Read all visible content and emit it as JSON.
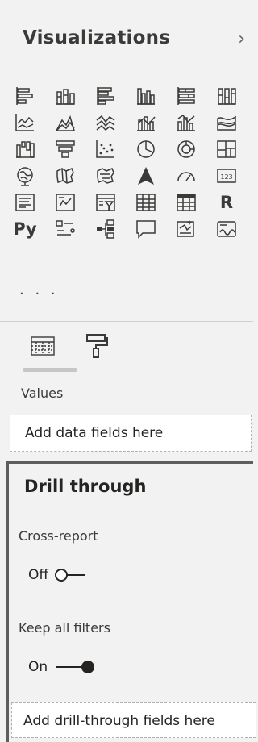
{
  "header": {
    "title": "Visualizations",
    "expand_glyph": "›"
  },
  "visuals": [
    {
      "icon": "stacked-bar-chart-icon"
    },
    {
      "icon": "stacked-column-chart-icon"
    },
    {
      "icon": "clustered-bar-chart-icon"
    },
    {
      "icon": "clustered-column-chart-icon"
    },
    {
      "icon": "100-percent-stacked-bar-chart-icon"
    },
    {
      "icon": "100-percent-stacked-column-chart-icon"
    },
    {
      "icon": "line-chart-icon"
    },
    {
      "icon": "area-chart-icon"
    },
    {
      "icon": "stacked-area-chart-icon"
    },
    {
      "icon": "line-and-stacked-column-chart-icon"
    },
    {
      "icon": "line-and-clustered-column-chart-icon"
    },
    {
      "icon": "ribbon-chart-icon"
    },
    {
      "icon": "waterfall-chart-icon"
    },
    {
      "icon": "funnel-icon"
    },
    {
      "icon": "scatter-chart-icon"
    },
    {
      "icon": "pie-chart-icon"
    },
    {
      "icon": "donut-chart-icon"
    },
    {
      "icon": "treemap-icon"
    },
    {
      "icon": "map-icon"
    },
    {
      "icon": "filled-map-icon"
    },
    {
      "icon": "shape-map-icon"
    },
    {
      "icon": "azure-map-icon"
    },
    {
      "icon": "gauge-icon"
    },
    {
      "icon": "card-icon",
      "text": "123"
    },
    {
      "icon": "multi-row-card-icon"
    },
    {
      "icon": "kpi-icon"
    },
    {
      "icon": "slicer-icon"
    },
    {
      "icon": "table-icon"
    },
    {
      "icon": "matrix-icon"
    },
    {
      "icon": "r-visual-icon",
      "text": "R"
    },
    {
      "icon": "python-visual-icon",
      "text": "Py"
    },
    {
      "icon": "key-influencers-icon"
    },
    {
      "icon": "decomposition-tree-icon"
    },
    {
      "icon": "qa-icon"
    },
    {
      "icon": "smart-narrative-icon"
    },
    {
      "icon": "paginated-report-icon"
    }
  ],
  "more_visuals": "· · ·",
  "tabs": [
    {
      "icon": "fields-tab-icon"
    },
    {
      "icon": "format-paint-roller-icon"
    }
  ],
  "values_section": {
    "label": "Values",
    "well_text": "Add data fields here"
  },
  "drill_through": {
    "title": "Drill through",
    "cross_report": {
      "label": "Cross-report",
      "state": "Off"
    },
    "keep_all_filters": {
      "label": "Keep all filters",
      "state": "On"
    },
    "well_text": "Add drill-through fields here"
  },
  "colors": {
    "panel_bg": "#f2f2f2",
    "icon": "#3b3a39",
    "accent_border": "#605e5c",
    "well_bg": "#ffffff"
  }
}
